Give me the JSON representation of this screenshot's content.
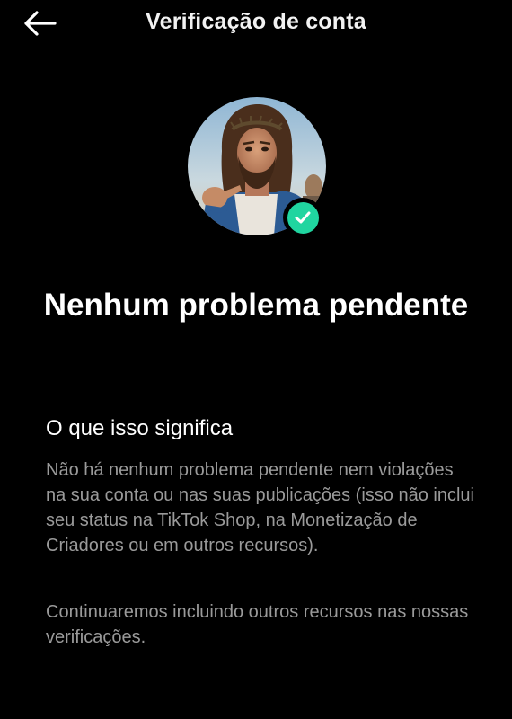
{
  "header": {
    "title": "Verificação de conta",
    "back_icon": "arrow-left-icon"
  },
  "profile": {
    "avatar_icon": "profile-photo",
    "badge_icon": "checkmark-icon",
    "badge_color": "#20d5a0"
  },
  "status": {
    "heading": "Nenhum problema pendente"
  },
  "info": {
    "title": "O que isso significa",
    "paragraph_1": "Não há nenhum problema pendente nem violações na sua conta ou nas suas publicações (isso não inclui seu status na TikTok Shop, na Monetização de Criadores ou em outros recursos).",
    "paragraph_2": "Continuaremos incluindo outros recursos nas nossas verificações."
  },
  "colors": {
    "background": "#000000",
    "primary_text": "#ffffff",
    "secondary_text": "#9a9a9a"
  }
}
